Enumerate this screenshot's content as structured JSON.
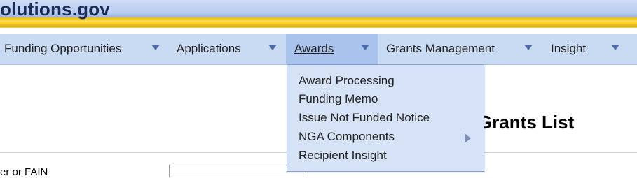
{
  "header": {
    "logo_text": "olutions.gov"
  },
  "nav": {
    "items": [
      {
        "label": "Funding Opportunities"
      },
      {
        "label": "Applications"
      },
      {
        "label": "Awards"
      },
      {
        "label": "Grants Management"
      },
      {
        "label": "Insight"
      }
    ],
    "active": "Awards"
  },
  "awards_menu": {
    "items": [
      {
        "label": "Award Processing"
      },
      {
        "label": "Funding Memo"
      },
      {
        "label": "Issue Not Funded Notice"
      },
      {
        "label": "NGA Components",
        "has_submenu": true
      },
      {
        "label": "Recipient Insight"
      }
    ]
  },
  "page": {
    "title": "Grants List",
    "field_label": "er or FAIN",
    "field_value": ""
  },
  "colors": {
    "nav_bg": "#c9daf3",
    "nav_active_bg": "#a9c3ed",
    "menu_bg": "#d6e3f6",
    "menu_border": "#7ea0d8",
    "caret": "#4a6aa8",
    "header_gold": "#f4c300",
    "logo_text": "#1b2c5c"
  },
  "icons": [
    "chevron-down-icon",
    "chevron-right-icon"
  ]
}
